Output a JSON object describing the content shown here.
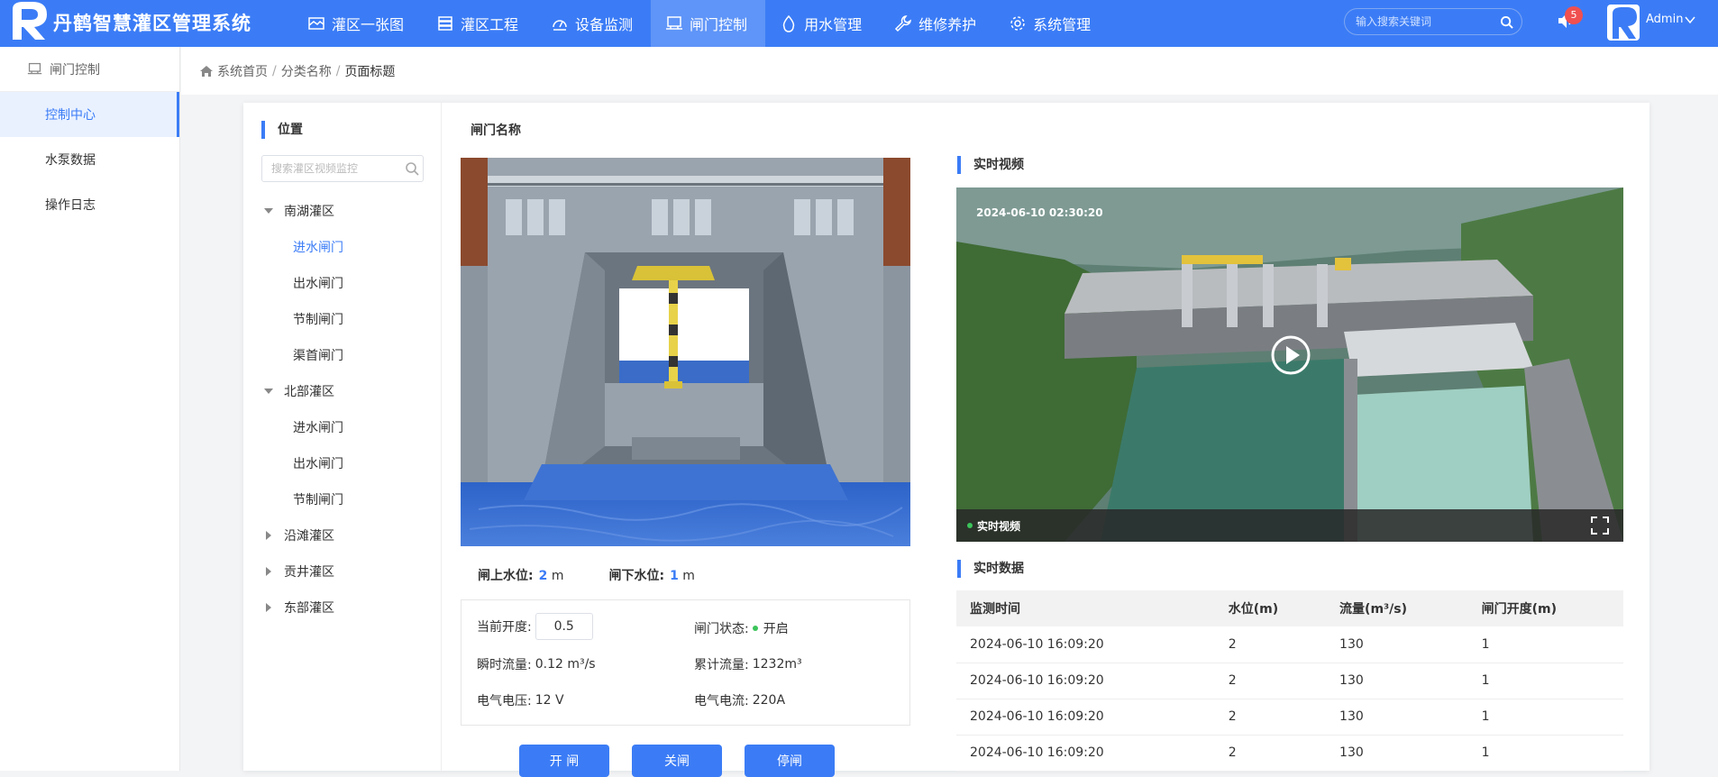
{
  "app": {
    "title": "丹鹤智慧灌区管理系统"
  },
  "nav": {
    "items": [
      {
        "label": "灌区一张图",
        "icon": "map-icon"
      },
      {
        "label": "灌区工程",
        "icon": "server-icon"
      },
      {
        "label": "设备监测",
        "icon": "monitor-gauge-icon"
      },
      {
        "label": "闸门控制",
        "icon": "gate-control-icon"
      },
      {
        "label": "用水管理",
        "icon": "water-drop-icon"
      },
      {
        "label": "维修养护",
        "icon": "wrench-icon"
      },
      {
        "label": "系统管理",
        "icon": "gear-icon"
      }
    ],
    "active": "闸门控制"
  },
  "search": {
    "placeholder": "输入搜索关键词"
  },
  "notifications": {
    "count": "5"
  },
  "user": {
    "name": "Admin"
  },
  "sidebar": {
    "header": "闸门控制",
    "items": [
      {
        "label": "控制中心"
      },
      {
        "label": "水泵数据"
      },
      {
        "label": "操作日志"
      }
    ],
    "active": "控制中心"
  },
  "breadcrumb": {
    "home": "系统首页",
    "category": "分类名称",
    "page": "页面标题"
  },
  "location": {
    "title": "位置",
    "search_placeholder": "搜索灌区视频监控",
    "tree": [
      {
        "label": "南湖灌区",
        "expanded": true,
        "children": [
          "进水闸门",
          "出水闸门",
          "节制闸门",
          "渠首闸门"
        ]
      },
      {
        "label": "北部灌区",
        "expanded": true,
        "children": [
          "进水闸门",
          "出水闸门",
          "节制闸门"
        ]
      },
      {
        "label": "沿滩灌区",
        "expanded": false,
        "children": []
      },
      {
        "label": "贡井灌区",
        "expanded": false,
        "children": []
      },
      {
        "label": "东部灌区",
        "expanded": false,
        "children": []
      }
    ],
    "selected": "进水闸门"
  },
  "gate": {
    "name_label": "闸门名称",
    "upstream_label": "闸上水位:",
    "upstream_value": "2",
    "downstream_label": "闸下水位:",
    "downstream_value": "1",
    "level_unit": "m",
    "opening_label": "当前开度:",
    "opening_value": "0.5",
    "status_label": "闸门状态:",
    "status_value": "开启",
    "instant_flow_label": "瞬时流量:",
    "instant_flow_value": "0.12 m³/s",
    "total_flow_label": "累计流量:",
    "total_flow_value": "1232m³",
    "voltage_label": "电气电压:",
    "voltage_value": "12 V",
    "current_label": "电气电流:",
    "current_value": "220A"
  },
  "buttons": {
    "open": "开 闸",
    "close": "关闸",
    "stop": "停闸"
  },
  "video": {
    "title": "实时视频",
    "timestamp": "2024-06-10 02:30:20",
    "live_label": "实时视频"
  },
  "realtime": {
    "title": "实时数据",
    "columns": [
      "监测时间",
      "水位(m)",
      "流量(m³/s)",
      "闸门开度(m)"
    ],
    "rows": [
      [
        "2024-06-10 16:09:20",
        "2",
        "130",
        "1"
      ],
      [
        "2024-06-10 16:09:20",
        "2",
        "130",
        "1"
      ],
      [
        "2024-06-10 16:09:20",
        "2",
        "130",
        "1"
      ],
      [
        "2024-06-10 16:09:20",
        "2",
        "130",
        "1"
      ]
    ]
  },
  "colors": {
    "primary": "#3b7cf6",
    "status_ok": "#3bc45a",
    "badge": "#f05050"
  }
}
